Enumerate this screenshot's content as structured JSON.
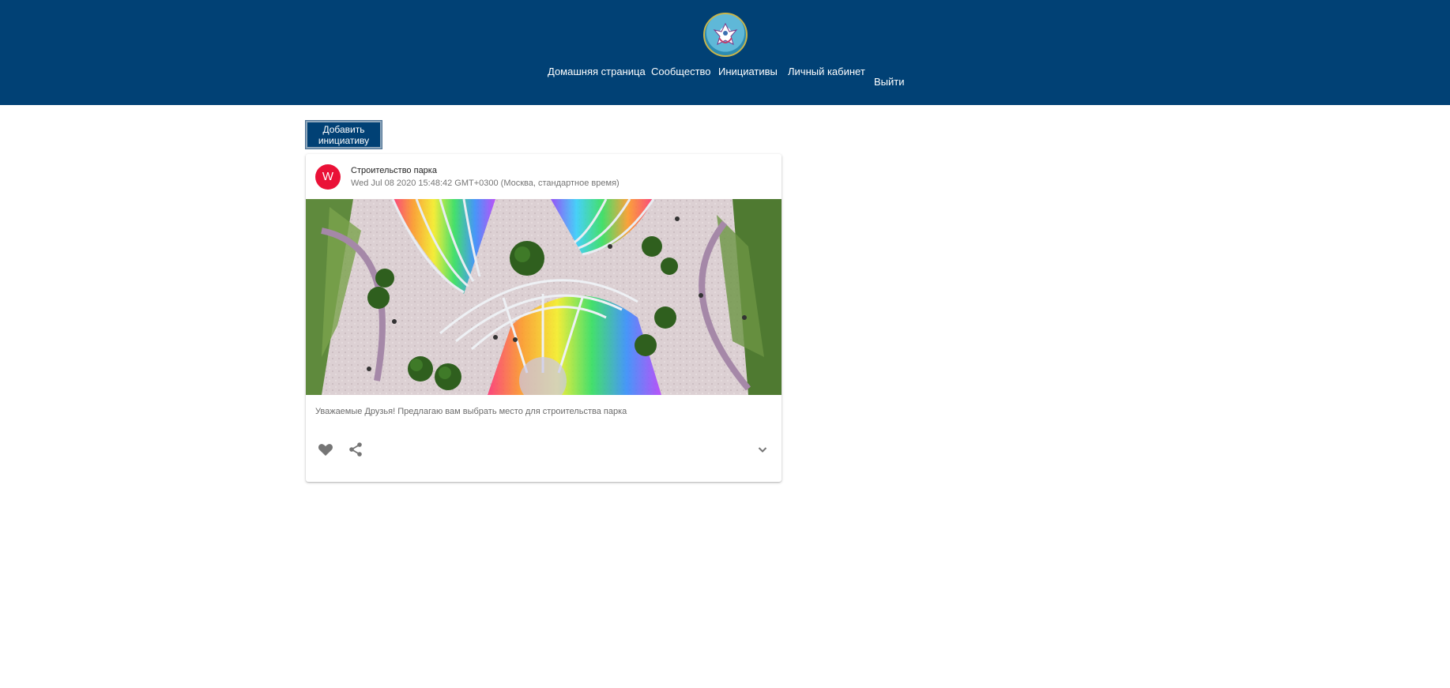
{
  "header": {
    "logo_icon": "coat-of-arms-emblem",
    "background_color": "#014175",
    "nav": {
      "home": "Домашняя страница",
      "community": "Сообщество",
      "initiatives": "Инициативы",
      "account": "Личный кабинет",
      "logout": "Выйти"
    }
  },
  "main": {
    "add_button_label_line1": "Добавить",
    "add_button_label_line2": "инициативу"
  },
  "post": {
    "avatar_letter": "W",
    "avatar_color": "#ea1137",
    "title": "Строительство парка",
    "date": "Wed Jul 08 2020 15:48:42 GMT+0300 (Москва, стандартное время)",
    "image_icon": "park-rendering-image",
    "text": "Уважаемые Друзья! Предлагаю вам выбрать место для строительства парка",
    "actions": {
      "like_icon": "heart-icon",
      "share_icon": "share-icon",
      "expand_icon": "chevron-down-icon"
    }
  }
}
